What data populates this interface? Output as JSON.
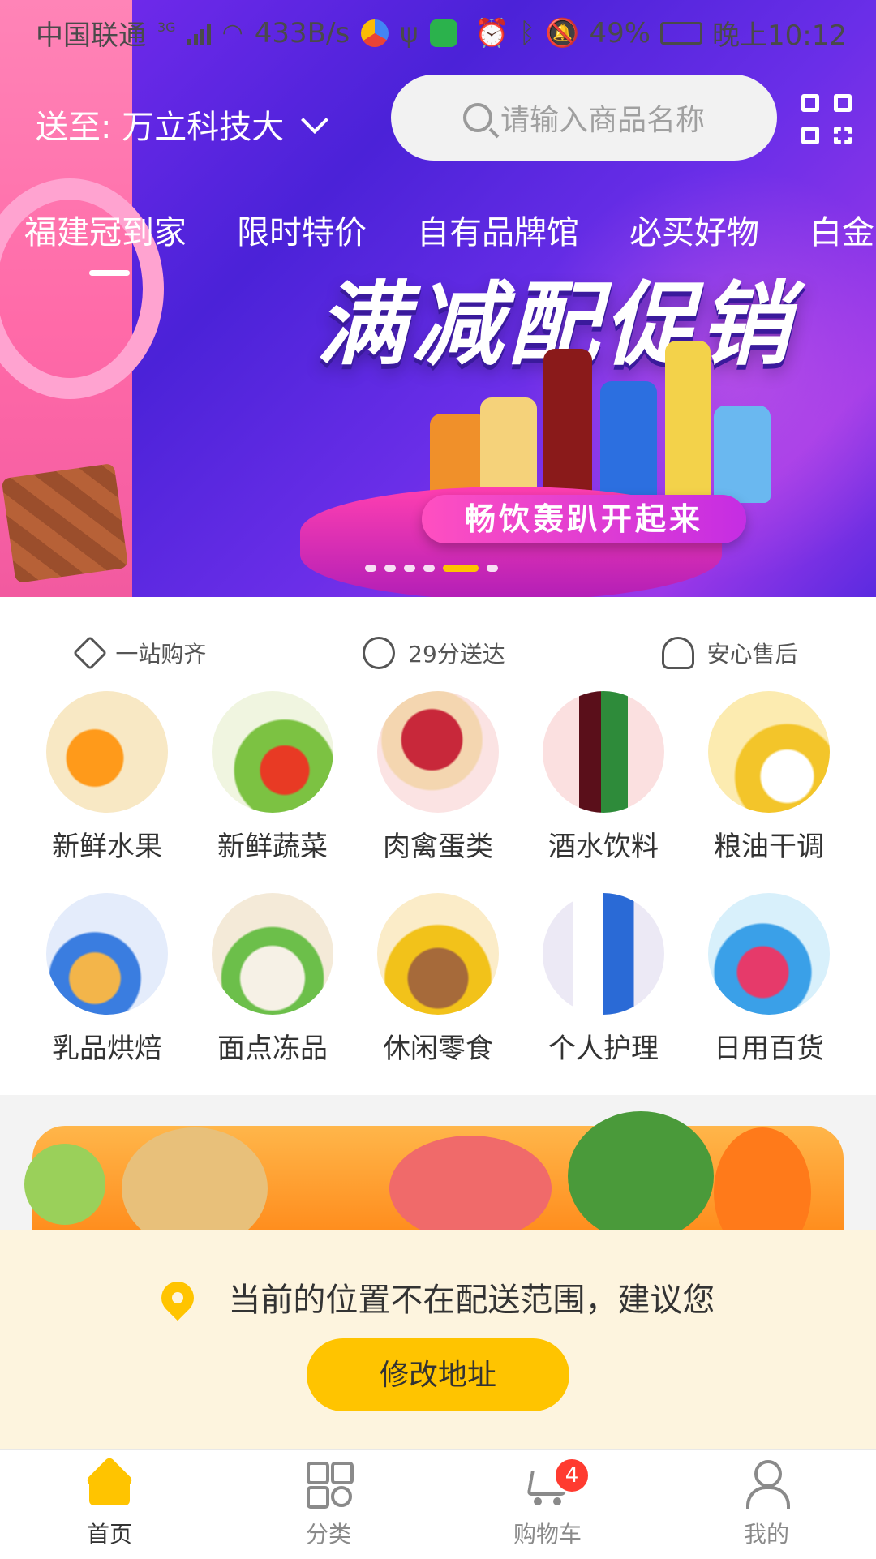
{
  "status_bar": {
    "carrier": "中国联通",
    "network_type": "3G",
    "speed": "433B/s",
    "battery": "49%",
    "time": "晚上10:12"
  },
  "header": {
    "deliver_to": "送至: 万立科技大",
    "search_placeholder": "请输入商品名称"
  },
  "tabs": [
    {
      "label": "福建冠到家",
      "active": true
    },
    {
      "label": "限时特价"
    },
    {
      "label": "自有品牌馆"
    },
    {
      "label": "必买好物"
    },
    {
      "label": "白金"
    }
  ],
  "banner": {
    "title": "满减配促销",
    "subtitle": "畅饮轰趴开起来",
    "slide_count": 6,
    "active_slide": 5
  },
  "features": [
    {
      "label": "一站购齐",
      "icon": "diamond-icon"
    },
    {
      "label": "29分送达",
      "icon": "delivery-clock-icon"
    },
    {
      "label": "安心售后",
      "icon": "headset-icon"
    }
  ],
  "categories": [
    {
      "label": "新鲜水果",
      "icon": "fruit-icon"
    },
    {
      "label": "新鲜蔬菜",
      "icon": "vegetable-icon"
    },
    {
      "label": "肉禽蛋类",
      "icon": "meat-egg-icon"
    },
    {
      "label": "酒水饮料",
      "icon": "drinks-icon"
    },
    {
      "label": "粮油干调",
      "icon": "grain-oil-icon"
    },
    {
      "label": "乳品烘焙",
      "icon": "dairy-bakery-icon"
    },
    {
      "label": "面点冻品",
      "icon": "dumpling-icon"
    },
    {
      "label": "休闲零食",
      "icon": "snack-icon"
    },
    {
      "label": "个人护理",
      "icon": "personal-care-icon"
    },
    {
      "label": "日用百货",
      "icon": "daily-goods-icon"
    }
  ],
  "notice": {
    "message": "当前的位置不在配送范围，建议您",
    "button": "修改地址"
  },
  "bottom_nav": [
    {
      "label": "首页",
      "icon": "home-icon",
      "active": true
    },
    {
      "label": "分类",
      "icon": "category-grid-icon"
    },
    {
      "label": "购物车",
      "icon": "cart-icon",
      "badge": "4"
    },
    {
      "label": "我的",
      "icon": "user-icon"
    }
  ],
  "colors": {
    "accent": "#ffc400",
    "banner_bg": "#5b2ae0",
    "notice_bg": "#fdf4de",
    "badge": "#ff3b30"
  }
}
